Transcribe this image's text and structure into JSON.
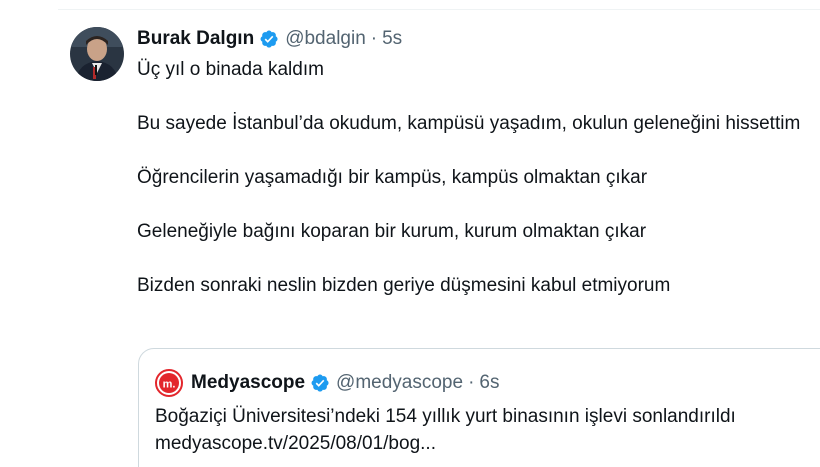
{
  "tweet": {
    "author_name": "Burak Dalgın",
    "handle": "@bdalgin",
    "separator": "·",
    "time": "5s",
    "paragraphs": [
      "Üç yıl o binada kaldım",
      "Bu sayede İstanbul’da okudum, kampüsü yaşadım, okulun geleneğini hissettim",
      "Öğrencilerin yaşamadığı bir kampüs, kampüs olmaktan çıkar",
      "Geleneğiyle bağını koparan bir kurum, kurum olmaktan çıkar",
      "Bizden sonraki neslin bizden geriye düşmesini kabul etmiyorum"
    ]
  },
  "quote": {
    "logo_text": "m.",
    "author_name": "Medyascope",
    "handle": "@medyascope",
    "separator": "·",
    "time": "6s",
    "text_line1": "Boğaziçi Üniversitesi’ndeki 154 yıllık yurt binasının işlevi sonlandırıldı",
    "text_line2": "medyascope.tv/2025/08/01/bog..."
  },
  "icons": {
    "verified": "verified-badge-icon",
    "avatar": "avatar"
  },
  "colors": {
    "text": "#0f1419",
    "secondary": "#536471",
    "verified_blue": "#1d9bf0",
    "border": "#cfd9de",
    "medyascope_red": "#e3262c"
  }
}
